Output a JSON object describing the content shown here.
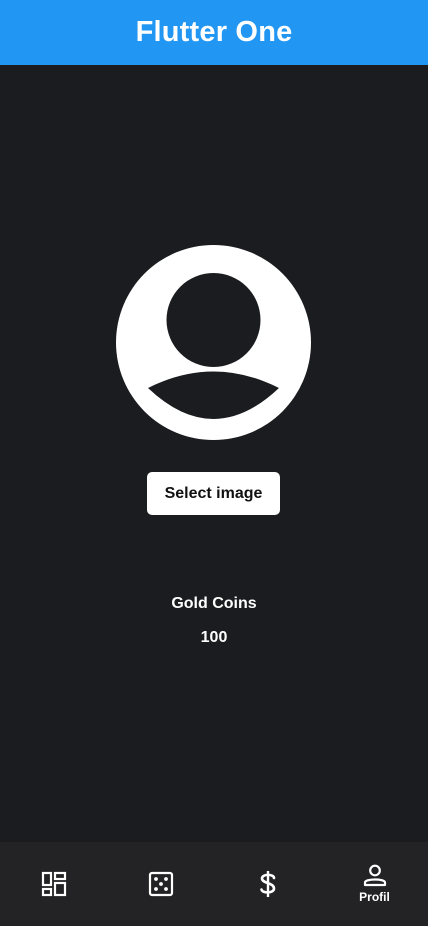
{
  "appbar": {
    "title": "Flutter One"
  },
  "profile": {
    "select_image_label": "Select image",
    "coins_label": "Gold Coins",
    "coins_value": "100"
  },
  "bottom_nav": {
    "items": [
      {
        "icon": "dashboard-icon",
        "label": ""
      },
      {
        "icon": "dice-icon",
        "label": ""
      },
      {
        "icon": "dollar-icon",
        "label": ""
      },
      {
        "icon": "person-icon",
        "label": "Profil",
        "selected": true
      }
    ]
  },
  "colors": {
    "appbar": "#2196f3",
    "background": "#1b1c1f",
    "bottom_nav": "#232325",
    "button": "#ffffff"
  }
}
